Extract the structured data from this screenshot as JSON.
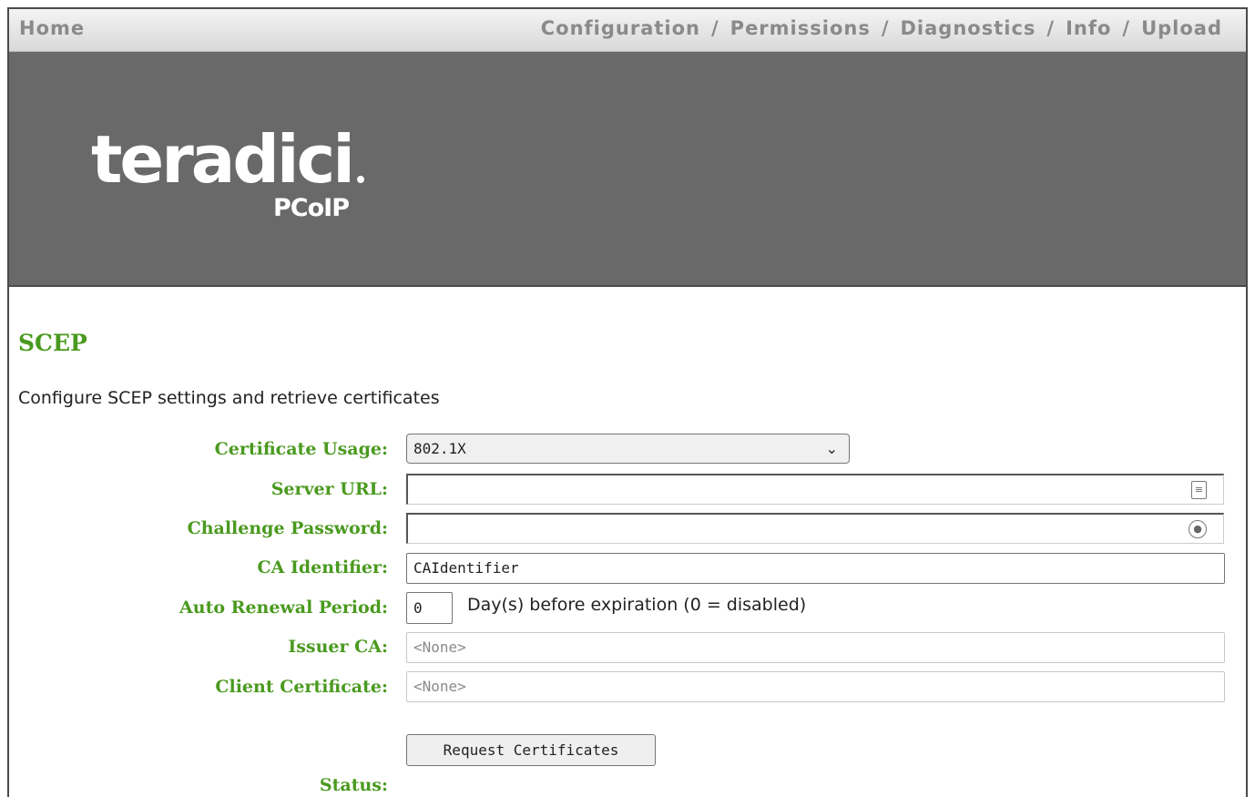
{
  "nav": {
    "home": "Home",
    "items": [
      "Configuration",
      "Permissions",
      "Diagnostics",
      "Info",
      "Upload"
    ],
    "separator": "/"
  },
  "banner": {
    "logo_word": "teradici",
    "logo_sub": "PCoIP"
  },
  "page": {
    "title": "SCEP",
    "subtitle": "Configure SCEP settings and retrieve certificates"
  },
  "form": {
    "certificate_usage": {
      "label": "Certificate Usage:",
      "value": "802.1X"
    },
    "server_url": {
      "label": "Server URL:",
      "value": ""
    },
    "challenge_password": {
      "label": "Challenge Password:",
      "value": ""
    },
    "ca_identifier": {
      "label": "CA Identifier:",
      "value": "CAIdentifier"
    },
    "auto_renewal": {
      "label": "Auto Renewal Period:",
      "value": "0",
      "note": "Day(s) before expiration (0 = disabled)"
    },
    "issuer_ca": {
      "label": "Issuer CA:",
      "value": "<None>"
    },
    "client_certificate": {
      "label": "Client Certificate:",
      "value": "<None>"
    },
    "request_button": "Request Certificates",
    "status": {
      "label": "Status:",
      "value": ""
    }
  },
  "colors": {
    "accent_green": "#4a9a1f",
    "banner_gray": "#696969"
  },
  "icons": {
    "server_url_field": "contact-card-icon",
    "password_field": "key-icon",
    "select_chevron": "chevron-down-icon"
  }
}
